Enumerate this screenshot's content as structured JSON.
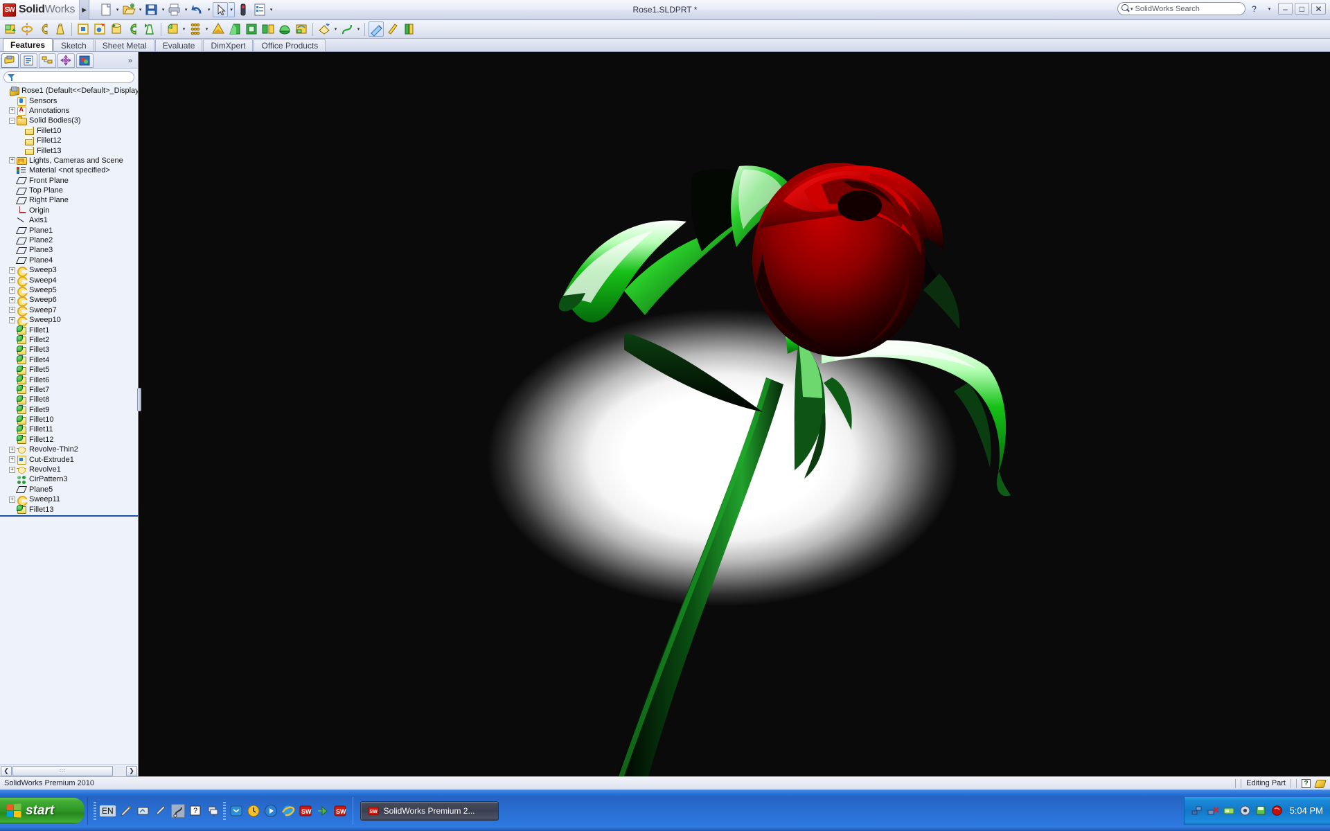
{
  "app": {
    "brand_bold": "Solid",
    "brand_light": "Works",
    "document_title": "Rose1.SLDPRT *",
    "search_placeholder": "SolidWorks Search",
    "help_label": "?",
    "minimize_label": "–",
    "maximize_label": "□",
    "close_label": "✕",
    "flyout_caret": "▶"
  },
  "toolbar": {
    "items": [
      {
        "name": "new-document-icon",
        "caret": true
      },
      {
        "name": "open-document-icon",
        "caret": true
      },
      {
        "name": "save-icon",
        "caret": true
      },
      {
        "name": "print-icon",
        "caret": true
      },
      {
        "name": "undo-icon",
        "caret": true
      },
      {
        "name": "select-icon",
        "caret": true
      },
      {
        "name": "rebuild-icon",
        "caret": false
      },
      {
        "name": "options-icon",
        "caret": true
      }
    ],
    "row2": [
      {
        "name": "extruded-boss-icon"
      },
      {
        "name": "revolved-boss-icon"
      },
      {
        "name": "swept-boss-icon"
      },
      {
        "name": "lofted-boss-icon"
      },
      {
        "name": "extruded-cut-icon"
      },
      {
        "name": "hole-wizard-icon"
      },
      {
        "name": "revolved-cut-icon"
      },
      {
        "name": "swept-cut-icon"
      },
      {
        "name": "lofted-cut-icon"
      },
      {
        "name": "fillet-icon"
      },
      {
        "name": "linear-pattern-icon"
      },
      {
        "name": "rib-icon"
      },
      {
        "name": "draft-icon"
      },
      {
        "name": "shell-icon"
      },
      {
        "name": "mirror-icon"
      },
      {
        "name": "dome-icon"
      },
      {
        "name": "wrap-icon"
      },
      {
        "name": "reference-geometry-icon"
      },
      {
        "name": "curves-icon"
      },
      {
        "name": "instant3d-icon"
      },
      {
        "name": "measure-icon"
      },
      {
        "name": "section-view-icon"
      }
    ]
  },
  "command_tabs": [
    {
      "label": "Features",
      "active": true
    },
    {
      "label": "Sketch",
      "active": false
    },
    {
      "label": "Sheet Metal",
      "active": false
    },
    {
      "label": "Evaluate",
      "active": false
    },
    {
      "label": "DimXpert",
      "active": false
    },
    {
      "label": "Office Products",
      "active": false
    }
  ],
  "panel": {
    "tabs": [
      {
        "name": "feature-manager-tab",
        "active": true
      },
      {
        "name": "property-manager-tab",
        "active": false
      },
      {
        "name": "configuration-manager-tab",
        "active": false
      },
      {
        "name": "dimxpert-manager-tab",
        "active": false
      },
      {
        "name": "display-manager-tab",
        "active": false
      }
    ],
    "more_label": "»",
    "filter_placeholder": "",
    "scroll_grip": "∶∶∶",
    "scroll_left": "❮",
    "scroll_right": "❯"
  },
  "tree": [
    {
      "label": "Rose1  (Default<<Default>_Display",
      "icon": "ic-part",
      "indent": 0,
      "expander": "none"
    },
    {
      "label": "Sensors",
      "icon": "ic-sensor",
      "indent": 1,
      "expander": "none"
    },
    {
      "label": "Annotations",
      "icon": "ic-annot",
      "indent": 1,
      "expander": "plus"
    },
    {
      "label": "Solid Bodies(3)",
      "icon": "ic-folder",
      "indent": 1,
      "expander": "minus"
    },
    {
      "label": "Fillet10",
      "icon": "ic-body",
      "indent": 2,
      "expander": "none"
    },
    {
      "label": "Fillet12",
      "icon": "ic-body",
      "indent": 2,
      "expander": "none"
    },
    {
      "label": "Fillet13",
      "icon": "ic-body",
      "indent": 2,
      "expander": "none"
    },
    {
      "label": "Lights, Cameras and Scene",
      "icon": "ic-lights",
      "indent": 1,
      "expander": "plus"
    },
    {
      "label": "Material <not specified>",
      "icon": "ic-material",
      "indent": 1,
      "expander": "none"
    },
    {
      "label": "Front Plane",
      "icon": "ic-plane",
      "indent": 1,
      "expander": "none"
    },
    {
      "label": "Top Plane",
      "icon": "ic-plane",
      "indent": 1,
      "expander": "none"
    },
    {
      "label": "Right Plane",
      "icon": "ic-plane",
      "indent": 1,
      "expander": "none"
    },
    {
      "label": "Origin",
      "icon": "ic-origin",
      "indent": 1,
      "expander": "none"
    },
    {
      "label": "Axis1",
      "icon": "ic-axis",
      "indent": 1,
      "expander": "none"
    },
    {
      "label": "Plane1",
      "icon": "ic-plane",
      "indent": 1,
      "expander": "none"
    },
    {
      "label": "Plane2",
      "icon": "ic-plane",
      "indent": 1,
      "expander": "none"
    },
    {
      "label": "Plane3",
      "icon": "ic-plane",
      "indent": 1,
      "expander": "none"
    },
    {
      "label": "Plane4",
      "icon": "ic-plane",
      "indent": 1,
      "expander": "none"
    },
    {
      "label": "Sweep3",
      "icon": "ic-sweep",
      "indent": 1,
      "expander": "plus"
    },
    {
      "label": "Sweep4",
      "icon": "ic-sweep",
      "indent": 1,
      "expander": "plus"
    },
    {
      "label": "Sweep5",
      "icon": "ic-sweep",
      "indent": 1,
      "expander": "plus"
    },
    {
      "label": "Sweep6",
      "icon": "ic-sweep",
      "indent": 1,
      "expander": "plus"
    },
    {
      "label": "Sweep7",
      "icon": "ic-sweep",
      "indent": 1,
      "expander": "plus"
    },
    {
      "label": "Sweep10",
      "icon": "ic-sweep",
      "indent": 1,
      "expander": "plus"
    },
    {
      "label": "Fillet1",
      "icon": "ic-fillet",
      "indent": 1,
      "expander": "none"
    },
    {
      "label": "Fillet2",
      "icon": "ic-fillet",
      "indent": 1,
      "expander": "none"
    },
    {
      "label": "Fillet3",
      "icon": "ic-fillet",
      "indent": 1,
      "expander": "none"
    },
    {
      "label": "Fillet4",
      "icon": "ic-fillet",
      "indent": 1,
      "expander": "none"
    },
    {
      "label": "Fillet5",
      "icon": "ic-fillet",
      "indent": 1,
      "expander": "none"
    },
    {
      "label": "Fillet6",
      "icon": "ic-fillet",
      "indent": 1,
      "expander": "none"
    },
    {
      "label": "Fillet7",
      "icon": "ic-fillet",
      "indent": 1,
      "expander": "none"
    },
    {
      "label": "Fillet8",
      "icon": "ic-fillet",
      "indent": 1,
      "expander": "none"
    },
    {
      "label": "Fillet9",
      "icon": "ic-fillet",
      "indent": 1,
      "expander": "none"
    },
    {
      "label": "Fillet10",
      "icon": "ic-fillet",
      "indent": 1,
      "expander": "none"
    },
    {
      "label": "Fillet11",
      "icon": "ic-fillet",
      "indent": 1,
      "expander": "none"
    },
    {
      "label": "Fillet12",
      "icon": "ic-fillet",
      "indent": 1,
      "expander": "none"
    },
    {
      "label": "Revolve-Thin2",
      "icon": "ic-revolve",
      "indent": 1,
      "expander": "plus"
    },
    {
      "label": "Cut-Extrude1",
      "icon": "ic-cut",
      "indent": 1,
      "expander": "plus"
    },
    {
      "label": "Revolve1",
      "icon": "ic-revolve",
      "indent": 1,
      "expander": "plus"
    },
    {
      "label": "CirPattern3",
      "icon": "ic-pattern",
      "indent": 1,
      "expander": "none"
    },
    {
      "label": "Plane5",
      "icon": "ic-plane",
      "indent": 1,
      "expander": "none"
    },
    {
      "label": "Sweep11",
      "icon": "ic-sweep",
      "indent": 1,
      "expander": "plus"
    },
    {
      "label": "Fillet13",
      "icon": "ic-fillet",
      "indent": 1,
      "expander": "none"
    }
  ],
  "viewport": {
    "model_name": "rose-3d-model",
    "background": "#000000",
    "spotlight_color": "#ffffff",
    "petal_color": "#a80000",
    "petal_highlight": "#d70000",
    "leaf_color": "#00b400",
    "leaf_highlight": "#8cff8c",
    "stem_color": "#0a5a14"
  },
  "status": {
    "left_text": "SolidWorks Premium 2010",
    "editing_text": "Editing Part",
    "help_glyph": "?"
  },
  "taskbar": {
    "start_label": "start",
    "language_indicator": "EN",
    "quicklaunch": [
      {
        "name": "pen-tool-icon"
      },
      {
        "name": "tablet-input-icon"
      },
      {
        "name": "ink-tool-icon"
      },
      {
        "name": "snipping-tool-icon"
      },
      {
        "name": "help-icon"
      },
      {
        "name": "show-desktop-icon"
      },
      {
        "name": "windows-messenger-icon"
      },
      {
        "name": "clock-utility-icon"
      },
      {
        "name": "media-player-icon"
      },
      {
        "name": "internet-explorer-icon"
      },
      {
        "name": "solidworks-launcher-icon"
      },
      {
        "name": "edrawings-icon"
      },
      {
        "name": "solidworks-explorer-icon"
      }
    ],
    "task_label": "SolidWorks Premium 2...",
    "tray_icons": [
      {
        "name": "network-icon"
      },
      {
        "name": "network-disconnected-icon"
      },
      {
        "name": "license-manager-icon"
      },
      {
        "name": "security-icon"
      },
      {
        "name": "backup-icon"
      },
      {
        "name": "antivirus-icon"
      }
    ],
    "clock": "5:04 PM"
  }
}
